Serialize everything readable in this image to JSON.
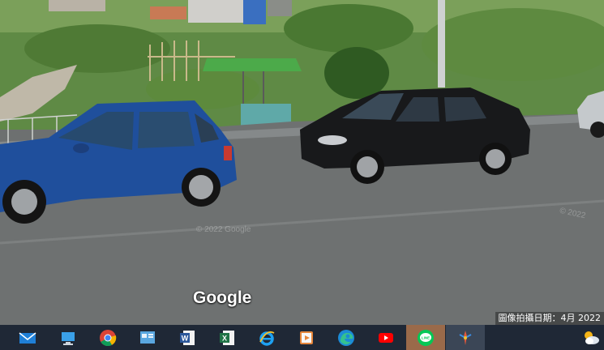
{
  "streetview": {
    "brand_logo": "Google",
    "watermark_1": "© 2022 Google",
    "watermark_2": "© 2022",
    "capture_date": "圖像拍攝日期：4月 2022"
  },
  "taskbar": {
    "items": [
      {
        "icon": "mail-icon"
      },
      {
        "icon": "this-pc-icon"
      },
      {
        "icon": "chrome-icon"
      },
      {
        "icon": "control-panel-icon"
      },
      {
        "icon": "word-icon"
      },
      {
        "icon": "excel-icon"
      },
      {
        "icon": "internet-explorer-icon"
      },
      {
        "icon": "media-player-icon"
      },
      {
        "icon": "edge-icon"
      },
      {
        "icon": "youtube-icon"
      },
      {
        "icon": "line-icon",
        "label": "LINE"
      },
      {
        "icon": "paint-icon"
      }
    ],
    "tray": {
      "icon": "weather-icon"
    }
  },
  "colors": {
    "taskbar_bg": "#1f2836",
    "active_item": "#9a6a4a",
    "blue_car": "#1f4f9c",
    "black_car": "#18191b"
  }
}
